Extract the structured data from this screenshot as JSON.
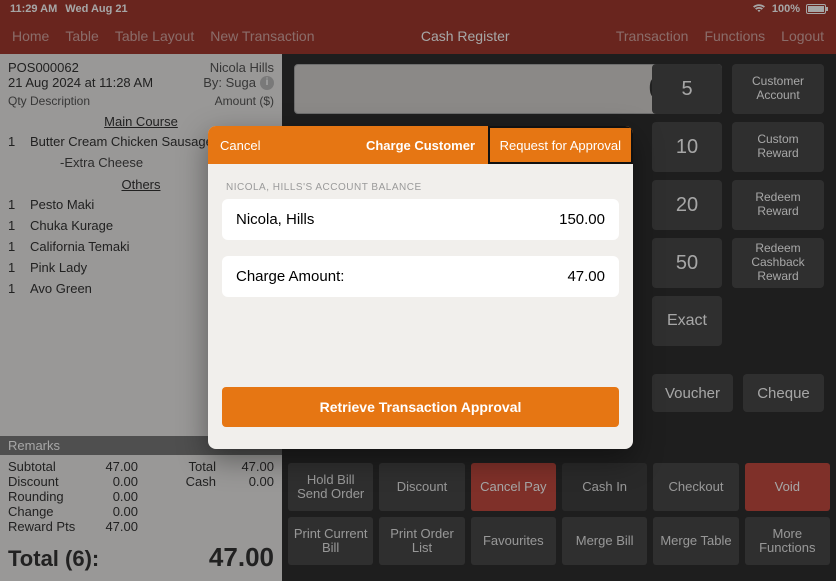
{
  "statusbar": {
    "time": "11:29 AM",
    "date": "Wed Aug 21",
    "battery": "100%"
  },
  "nav": {
    "left": [
      "Home",
      "Table",
      "Table Layout",
      "New Transaction"
    ],
    "title": "Cash Register",
    "right": [
      "Transaction",
      "Functions",
      "Logout"
    ]
  },
  "receipt": {
    "pos": "POS000062",
    "customer": "Nicola Hills",
    "datetime": "21 Aug 2024 at 11:28 AM",
    "by": "By: Suga",
    "col_qty": "Qty",
    "col_desc": "Description",
    "col_amt": "Amount ($)",
    "sections": [
      {
        "title": "Main Course",
        "items": [
          {
            "qty": "1",
            "desc": "Butter Cream Chicken Sausage",
            "subs": [
              "-Extra Cheese"
            ]
          }
        ]
      },
      {
        "title": "Others",
        "items": [
          {
            "qty": "1",
            "desc": "Pesto Maki"
          },
          {
            "qty": "1",
            "desc": "Chuka Kurage"
          },
          {
            "qty": "1",
            "desc": "California Temaki"
          },
          {
            "qty": "1",
            "desc": "Pink Lady"
          },
          {
            "qty": "1",
            "desc": "Avo Green"
          }
        ]
      }
    ],
    "remarks_label": "Remarks",
    "totals": {
      "rows": [
        {
          "l": "Subtotal",
          "v": "47.00",
          "l2": "Total",
          "v2": "47.00"
        },
        {
          "l": "Discount",
          "v": "0.00",
          "l2": "Cash",
          "v2": "0.00"
        },
        {
          "l": "Rounding",
          "v": "0.00",
          "l2": "",
          "v2": ""
        },
        {
          "l": "Change",
          "v": "0.00",
          "l2": "",
          "v2": ""
        },
        {
          "l": "Reward Pts",
          "v": "47.00",
          "l2": "",
          "v2": ""
        }
      ],
      "grand_label": "Total (6):",
      "grand_value": "47.00"
    }
  },
  "display_value": "0.00",
  "sidebtns": [
    "Customer Account",
    "Custom Reward",
    "Redeem Reward",
    "Redeem Cashback Reward"
  ],
  "quickamts": [
    "5",
    "10",
    "20",
    "50",
    "Exact"
  ],
  "pay_extra": [
    "Voucher",
    "Cheque"
  ],
  "fn_rows": [
    [
      {
        "t": "Hold Bill Send Order",
        "cls": "dark"
      },
      {
        "t": "Discount",
        "cls": "dark"
      },
      {
        "t": "Cancel Pay",
        "cls": "red"
      },
      {
        "t": "Cash In",
        "cls": "dark2"
      },
      {
        "t": "Checkout",
        "cls": "dark"
      },
      {
        "t": "Void",
        "cls": "red"
      }
    ],
    [
      {
        "t": "Print Current Bill",
        "cls": "dark"
      },
      {
        "t": "Print Order List",
        "cls": "dark"
      },
      {
        "t": "Favourites",
        "cls": "dark"
      },
      {
        "t": "Merge Bill",
        "cls": "dark"
      },
      {
        "t": "Merge Table",
        "cls": "dark"
      },
      {
        "t": "More Functions",
        "cls": "dark"
      }
    ]
  ],
  "modal": {
    "cancel": "Cancel",
    "title": "Charge Customer",
    "request": "Request for Approval",
    "acct_label": "NICOLA, HILLS'S ACCOUNT BALANCE",
    "acct_name": "Nicola, Hills",
    "acct_balance": "150.00",
    "charge_label": "Charge Amount:",
    "charge_value": "47.00",
    "retrieve": "Retrieve Transaction Approval"
  }
}
